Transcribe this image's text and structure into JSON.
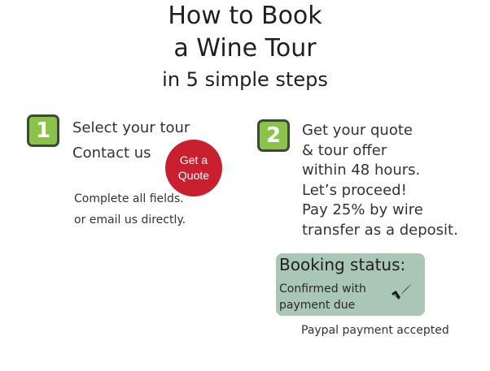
{
  "header": {
    "line1": "How to Book",
    "line2": "a Wine Tour",
    "line3": "in 5 simple steps"
  },
  "step1": {
    "number": "1",
    "line1": "Select your tour",
    "line2": "Contact us",
    "note1": "Complete all fields.",
    "note2": "or email us directly.",
    "quote_button": {
      "line1": "Get a",
      "line2": "Quote"
    }
  },
  "step2": {
    "number": "2",
    "lines": [
      "Get your quote",
      "& tour offer",
      "within 48 hours.",
      "Let’s proceed!",
      "Pay 25% by wire",
      "transfer as a deposit."
    ]
  },
  "booking_status": {
    "heading": "Booking status:",
    "value_line1": "Confirmed with",
    "value_line2": "payment due",
    "icon": "check-icon"
  },
  "paypal_note": "Paypal payment accepted",
  "colors": {
    "badge_green": "#8bc34a",
    "badge_border": "#3b4a33",
    "quote_red": "#c8202f",
    "status_bg": "#a9c6b6"
  }
}
